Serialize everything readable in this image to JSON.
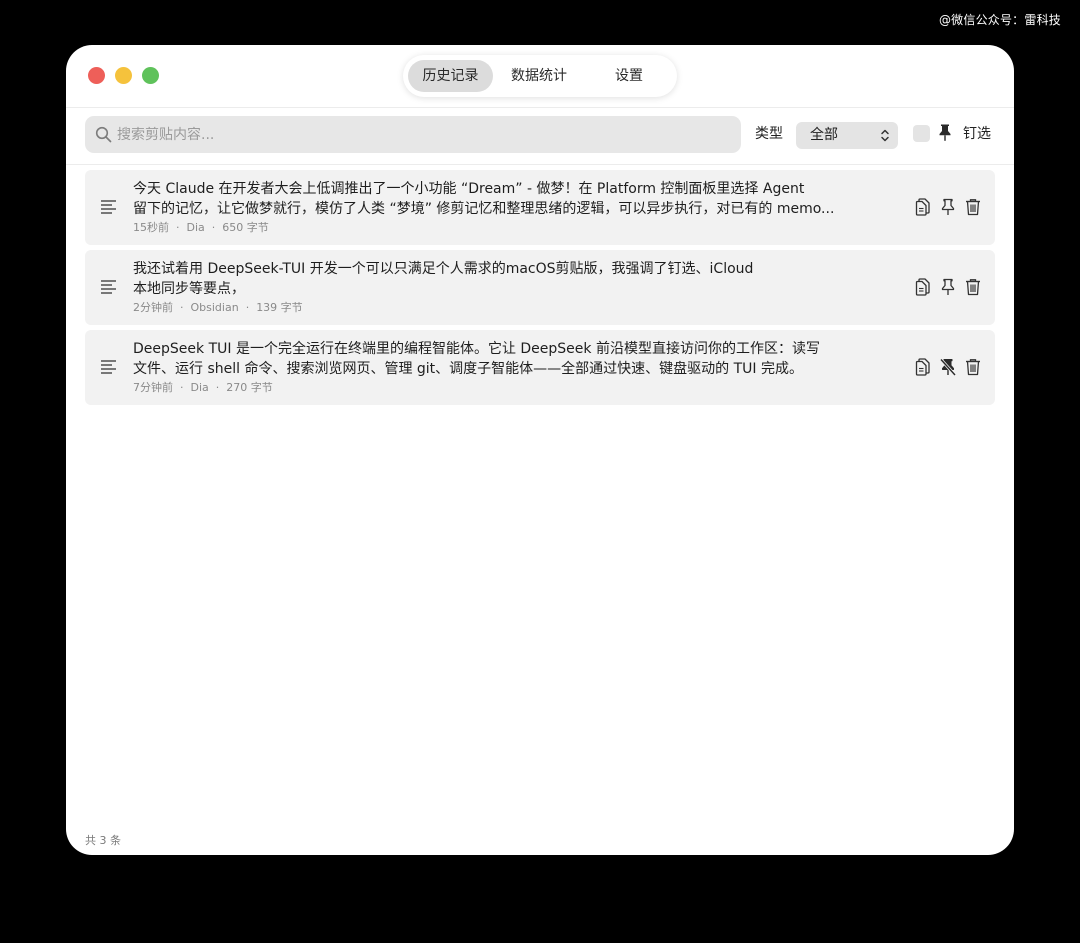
{
  "watermark": "@微信公众号：雷科技",
  "tabs": [
    {
      "label": "历史记录",
      "active": true
    },
    {
      "label": "数据统计",
      "active": false
    },
    {
      "label": "设置",
      "active": false
    }
  ],
  "toolbar": {
    "search_placeholder": "搜索剪贴内容...",
    "search_icon": "search-icon",
    "type_label": "类型",
    "type_value": "全部",
    "pin_filter_checked": false,
    "pin_filter_label": "钉选"
  },
  "items": [
    {
      "line1": "今天 Claude 在开发者大会上低调推出了一个小功能 “Dream” - 做梦！在 Platform 控制面板里选择 Agent",
      "line2": "留下的记忆，让它做梦就行，模仿了人类 “梦境” 修剪记忆和整理思绪的逻辑，可以异步执行，对已有的 memo...",
      "time": "15秒前",
      "source": "Dia",
      "size": "650 字节",
      "pinned": false
    },
    {
      "line1": "我还试着用 DeepSeek-TUI 开发一个可以只满足个人需求的macOS剪贴版，我强调了钉选、iCloud",
      "line2": "本地同步等要点，",
      "time": "2分钟前",
      "source": "Obsidian",
      "size": "139 字节",
      "pinned": false
    },
    {
      "line1": "DeepSeek TUI 是一个完全运行在终端里的编程智能体。它让 DeepSeek 前沿模型直接访问你的工作区：读写",
      "line2": "文件、运行 shell 命令、搜索浏览网页、管理 git、调度子智能体——全部通过快速、键盘驱动的 TUI 完成。",
      "time": "7分钟前",
      "source": "Dia",
      "size": "270 字节",
      "pinned": true
    }
  ],
  "footer": "共 3 条",
  "colors": {
    "close": "#ee5f59",
    "minimize": "#f5c23c",
    "maximize": "#5fc25b",
    "active_tab": "#dcdcdc",
    "row_background": "#f2f2f2"
  }
}
